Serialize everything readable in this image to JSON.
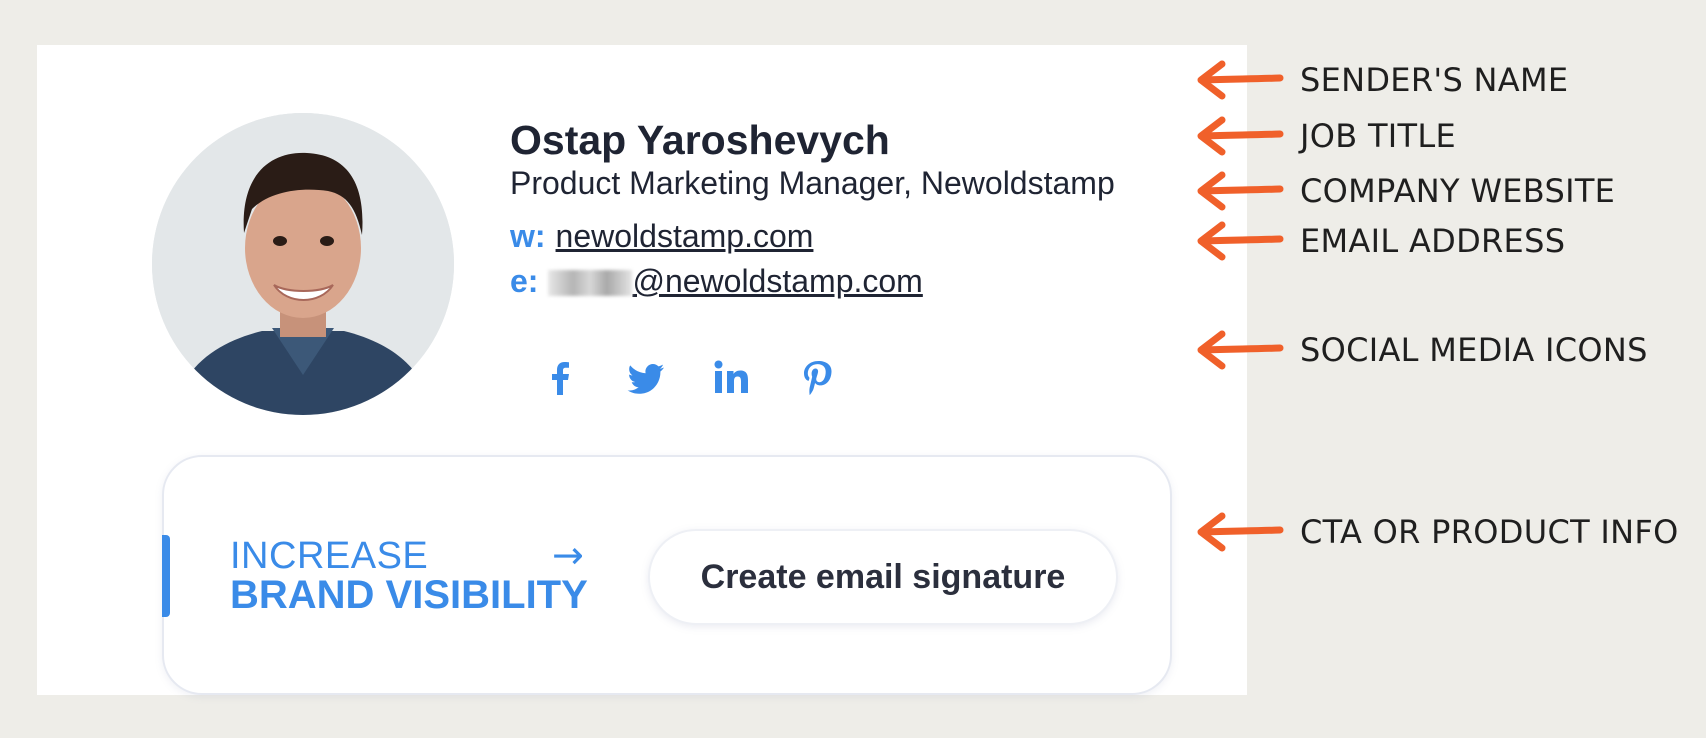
{
  "signature": {
    "sender_name": "Ostap Yaroshevych",
    "job_title": "Product Marketing Manager, Newoldstamp",
    "website_prefix": "w:",
    "website": "newoldstamp.com",
    "email_prefix": "e:",
    "email_visible": "@newoldstamp.com",
    "social_icons": [
      "facebook-icon",
      "twitter-icon",
      "linkedin-icon",
      "pinterest-icon"
    ],
    "accent_color": "#3a8be8"
  },
  "cta": {
    "line1": "INCREASE",
    "arrow": "→",
    "line2": "BRAND VISIBILITY",
    "button_label": "Create email signature"
  },
  "callouts": [
    "SENDER'S NAME",
    "JOB TITLE",
    "COMPANY WEBSITE",
    "EMAIL ADDRESS",
    "SOCIAL MEDIA ICONS",
    "CTA OR PRODUCT INFO"
  ],
  "callout_color": "#f0602a"
}
